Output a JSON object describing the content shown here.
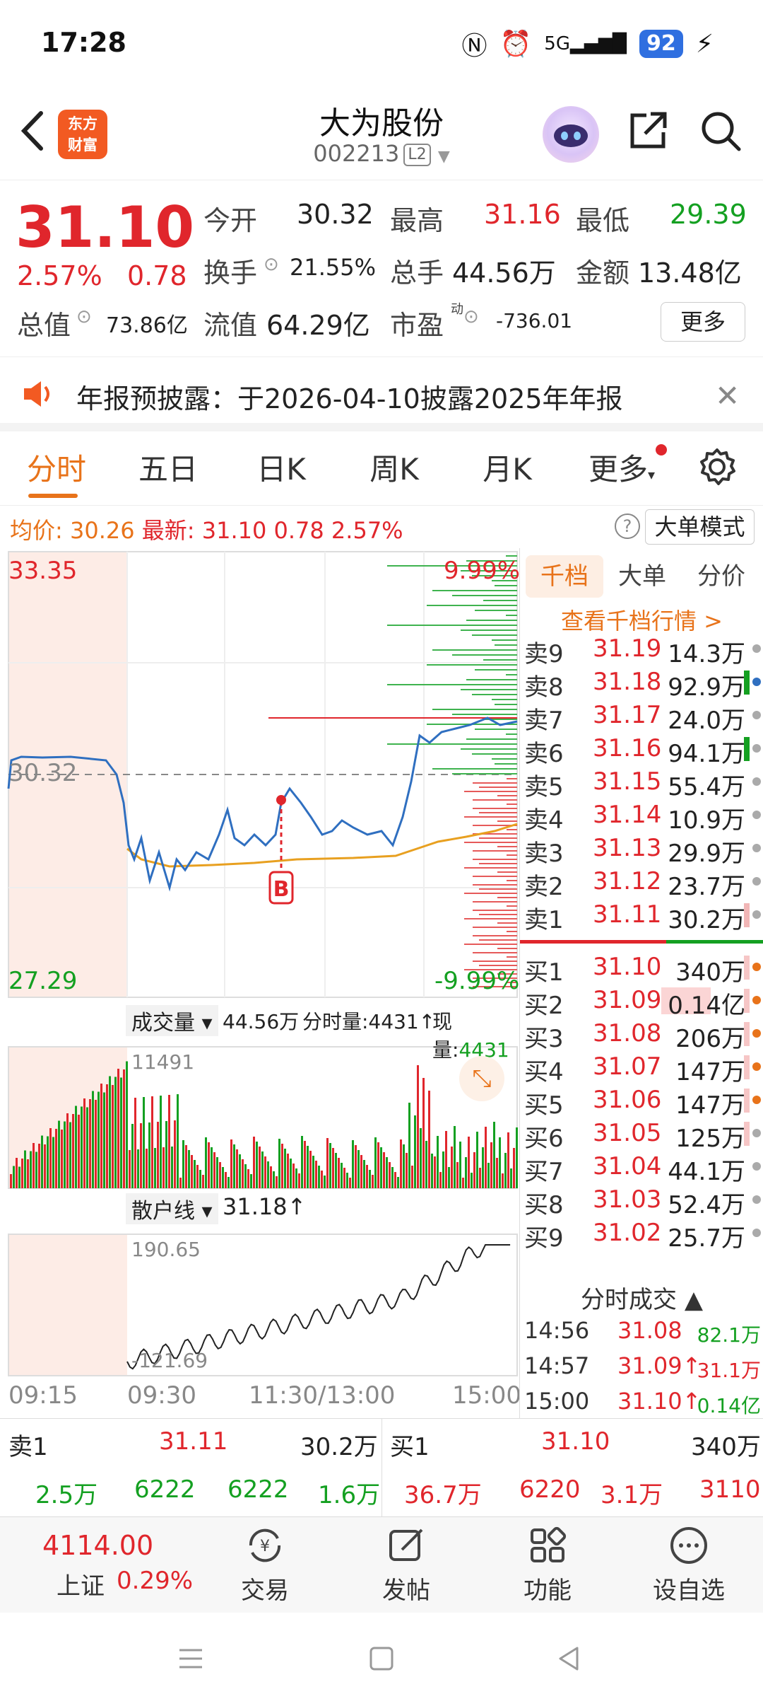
{
  "status": {
    "time": "17:28",
    "network": "5G",
    "battery": "92"
  },
  "header": {
    "logo_line1": "东方",
    "logo_line2": "财富",
    "name": "大为股份",
    "code": "002213",
    "level": "L2"
  },
  "quote": {
    "price": "31.10",
    "pct": "2.57%",
    "chg": "0.78",
    "open_label": "今开",
    "open": "30.32",
    "high_label": "最高",
    "high": "31.16",
    "low_label": "最低",
    "low": "29.39",
    "turnover_label": "换手",
    "turnover": "21.55%",
    "volume_label": "总手",
    "volume": "44.56万",
    "amount_label": "金额",
    "amount": "13.48亿",
    "mktcap_label": "总值",
    "mktcap": "73.86亿",
    "float_label": "流值",
    "float": "64.29亿",
    "pe_label": "市盈",
    "pe_sup": "动",
    "pe": "-736.01",
    "more": "更多"
  },
  "notice": {
    "text": "年报预披露：于2026-04-10披露2025年年报"
  },
  "tabs": [
    "分时",
    "五日",
    "日K",
    "周K",
    "月K",
    "更多"
  ],
  "info": {
    "avg_label": "均价:",
    "avg": "30.26",
    "latest_label": "最新:",
    "latest": "31.10",
    "chg": "0.78",
    "pct": "2.57%",
    "big_mode": "大单模式"
  },
  "chart": {
    "top_price": "33.35",
    "mid_price": "30.32",
    "bottom_price": "27.29",
    "top_pct": "9.99%",
    "bottom_pct": "-9.99%",
    "marker": "B",
    "vol_dropdown": "成交量",
    "vol_total": "44.56万",
    "vol_tick_label": "分时量:4431↑",
    "vol_now_label": "现量:",
    "vol_now": "4431",
    "vol_max": "11491",
    "retail_dropdown": "散户线",
    "retail_value": "31.18↑",
    "retail_max": "190.65",
    "retail_min": "-121.69",
    "times": [
      "09:15",
      "09:30",
      "11:30/13:00",
      "15:00"
    ]
  },
  "orderbook": {
    "tabs": [
      "千档",
      "大单",
      "分价"
    ],
    "link": "查看千档行情 >",
    "asks": [
      {
        "label": "卖9",
        "price": "31.19",
        "vol": "14.3万"
      },
      {
        "label": "卖8",
        "price": "31.18",
        "vol": "92.9万"
      },
      {
        "label": "卖7",
        "price": "31.17",
        "vol": "24.0万"
      },
      {
        "label": "卖6",
        "price": "31.16",
        "vol": "94.1万"
      },
      {
        "label": "卖5",
        "price": "31.15",
        "vol": "55.4万"
      },
      {
        "label": "卖4",
        "price": "31.14",
        "vol": "10.9万"
      },
      {
        "label": "卖3",
        "price": "31.13",
        "vol": "29.9万"
      },
      {
        "label": "卖2",
        "price": "31.12",
        "vol": "23.7万"
      },
      {
        "label": "卖1",
        "price": "31.11",
        "vol": "30.2万"
      }
    ],
    "bids": [
      {
        "label": "买1",
        "price": "31.10",
        "vol": "340万"
      },
      {
        "label": "买2",
        "price": "31.09",
        "vol": "0.14亿"
      },
      {
        "label": "买3",
        "price": "31.08",
        "vol": "206万"
      },
      {
        "label": "买4",
        "price": "31.07",
        "vol": "147万"
      },
      {
        "label": "买5",
        "price": "31.06",
        "vol": "147万"
      },
      {
        "label": "买6",
        "price": "31.05",
        "vol": "125万"
      },
      {
        "label": "买7",
        "price": "31.04",
        "vol": "44.1万"
      },
      {
        "label": "买8",
        "price": "31.03",
        "vol": "52.4万"
      },
      {
        "label": "买9",
        "price": "31.02",
        "vol": "25.7万"
      }
    ],
    "trade_title": "分时成交",
    "trades": [
      {
        "time": "14:56",
        "price": "31.08",
        "vol": "82.1万"
      },
      {
        "time": "14:57",
        "price": "31.09↑",
        "vol": "31.1万"
      },
      {
        "time": "15:00",
        "price": "31.10↑",
        "vol": "0.14亿"
      }
    ]
  },
  "summary": {
    "ask_label": "卖1",
    "ask_price": "31.11",
    "ask_vol": "30.2万",
    "bid_label": "买1",
    "bid_price": "31.10",
    "bid_vol": "340万",
    "row2": [
      "2.5万",
      "6222",
      "6222",
      "1.6万",
      "36.7万",
      "6220",
      "3.1万",
      "3110"
    ]
  },
  "bottomnav": {
    "index_value": "4114.00",
    "index_name": "上证",
    "index_pct": "0.29%",
    "items": [
      "交易",
      "发帖",
      "功能",
      "设自选"
    ]
  }
}
